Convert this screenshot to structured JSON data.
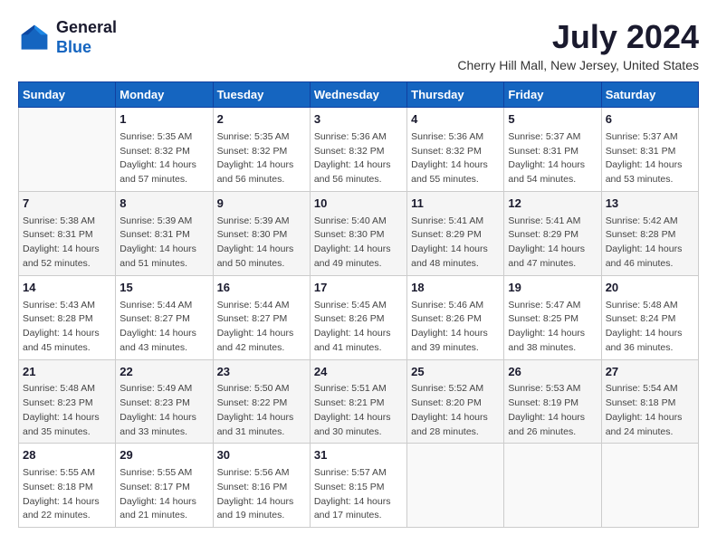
{
  "header": {
    "logo_line1": "General",
    "logo_line2": "Blue",
    "month_title": "July 2024",
    "location": "Cherry Hill Mall, New Jersey, United States"
  },
  "calendar": {
    "days_of_week": [
      "Sunday",
      "Monday",
      "Tuesday",
      "Wednesday",
      "Thursday",
      "Friday",
      "Saturday"
    ],
    "weeks": [
      [
        {
          "day": "",
          "info": ""
        },
        {
          "day": "1",
          "info": "Sunrise: 5:35 AM\nSunset: 8:32 PM\nDaylight: 14 hours\nand 57 minutes."
        },
        {
          "day": "2",
          "info": "Sunrise: 5:35 AM\nSunset: 8:32 PM\nDaylight: 14 hours\nand 56 minutes."
        },
        {
          "day": "3",
          "info": "Sunrise: 5:36 AM\nSunset: 8:32 PM\nDaylight: 14 hours\nand 56 minutes."
        },
        {
          "day": "4",
          "info": "Sunrise: 5:36 AM\nSunset: 8:32 PM\nDaylight: 14 hours\nand 55 minutes."
        },
        {
          "day": "5",
          "info": "Sunrise: 5:37 AM\nSunset: 8:31 PM\nDaylight: 14 hours\nand 54 minutes."
        },
        {
          "day": "6",
          "info": "Sunrise: 5:37 AM\nSunset: 8:31 PM\nDaylight: 14 hours\nand 53 minutes."
        }
      ],
      [
        {
          "day": "7",
          "info": "Sunrise: 5:38 AM\nSunset: 8:31 PM\nDaylight: 14 hours\nand 52 minutes."
        },
        {
          "day": "8",
          "info": "Sunrise: 5:39 AM\nSunset: 8:31 PM\nDaylight: 14 hours\nand 51 minutes."
        },
        {
          "day": "9",
          "info": "Sunrise: 5:39 AM\nSunset: 8:30 PM\nDaylight: 14 hours\nand 50 minutes."
        },
        {
          "day": "10",
          "info": "Sunrise: 5:40 AM\nSunset: 8:30 PM\nDaylight: 14 hours\nand 49 minutes."
        },
        {
          "day": "11",
          "info": "Sunrise: 5:41 AM\nSunset: 8:29 PM\nDaylight: 14 hours\nand 48 minutes."
        },
        {
          "day": "12",
          "info": "Sunrise: 5:41 AM\nSunset: 8:29 PM\nDaylight: 14 hours\nand 47 minutes."
        },
        {
          "day": "13",
          "info": "Sunrise: 5:42 AM\nSunset: 8:28 PM\nDaylight: 14 hours\nand 46 minutes."
        }
      ],
      [
        {
          "day": "14",
          "info": "Sunrise: 5:43 AM\nSunset: 8:28 PM\nDaylight: 14 hours\nand 45 minutes."
        },
        {
          "day": "15",
          "info": "Sunrise: 5:44 AM\nSunset: 8:27 PM\nDaylight: 14 hours\nand 43 minutes."
        },
        {
          "day": "16",
          "info": "Sunrise: 5:44 AM\nSunset: 8:27 PM\nDaylight: 14 hours\nand 42 minutes."
        },
        {
          "day": "17",
          "info": "Sunrise: 5:45 AM\nSunset: 8:26 PM\nDaylight: 14 hours\nand 41 minutes."
        },
        {
          "day": "18",
          "info": "Sunrise: 5:46 AM\nSunset: 8:26 PM\nDaylight: 14 hours\nand 39 minutes."
        },
        {
          "day": "19",
          "info": "Sunrise: 5:47 AM\nSunset: 8:25 PM\nDaylight: 14 hours\nand 38 minutes."
        },
        {
          "day": "20",
          "info": "Sunrise: 5:48 AM\nSunset: 8:24 PM\nDaylight: 14 hours\nand 36 minutes."
        }
      ],
      [
        {
          "day": "21",
          "info": "Sunrise: 5:48 AM\nSunset: 8:23 PM\nDaylight: 14 hours\nand 35 minutes."
        },
        {
          "day": "22",
          "info": "Sunrise: 5:49 AM\nSunset: 8:23 PM\nDaylight: 14 hours\nand 33 minutes."
        },
        {
          "day": "23",
          "info": "Sunrise: 5:50 AM\nSunset: 8:22 PM\nDaylight: 14 hours\nand 31 minutes."
        },
        {
          "day": "24",
          "info": "Sunrise: 5:51 AM\nSunset: 8:21 PM\nDaylight: 14 hours\nand 30 minutes."
        },
        {
          "day": "25",
          "info": "Sunrise: 5:52 AM\nSunset: 8:20 PM\nDaylight: 14 hours\nand 28 minutes."
        },
        {
          "day": "26",
          "info": "Sunrise: 5:53 AM\nSunset: 8:19 PM\nDaylight: 14 hours\nand 26 minutes."
        },
        {
          "day": "27",
          "info": "Sunrise: 5:54 AM\nSunset: 8:18 PM\nDaylight: 14 hours\nand 24 minutes."
        }
      ],
      [
        {
          "day": "28",
          "info": "Sunrise: 5:55 AM\nSunset: 8:18 PM\nDaylight: 14 hours\nand 22 minutes."
        },
        {
          "day": "29",
          "info": "Sunrise: 5:55 AM\nSunset: 8:17 PM\nDaylight: 14 hours\nand 21 minutes."
        },
        {
          "day": "30",
          "info": "Sunrise: 5:56 AM\nSunset: 8:16 PM\nDaylight: 14 hours\nand 19 minutes."
        },
        {
          "day": "31",
          "info": "Sunrise: 5:57 AM\nSunset: 8:15 PM\nDaylight: 14 hours\nand 17 minutes."
        },
        {
          "day": "",
          "info": ""
        },
        {
          "day": "",
          "info": ""
        },
        {
          "day": "",
          "info": ""
        }
      ]
    ]
  }
}
